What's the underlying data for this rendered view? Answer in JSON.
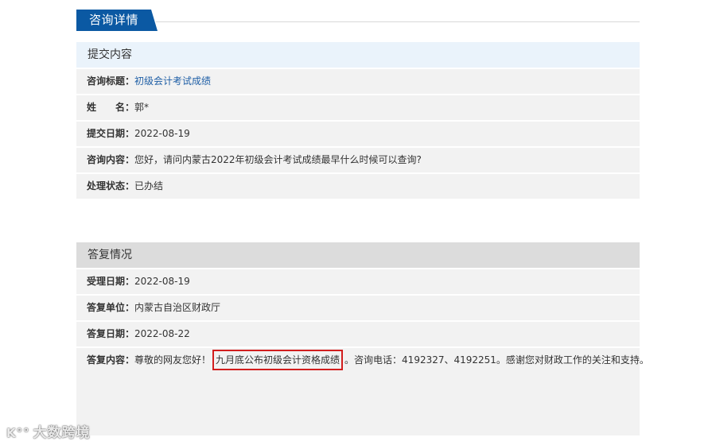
{
  "page_title": "咨询详情",
  "submit": {
    "header": "提交内容",
    "title_label": "咨询标题：",
    "title_value": "初级会计考试成绩",
    "name_label": "姓　　名：",
    "name_value": "郭*",
    "date_label": "提交日期：",
    "date_value": "2022-08-19",
    "content_label": "咨询内容：",
    "content_value": "您好，请问内蒙古2022年初级会计考试成绩最早什么时候可以查询?",
    "status_label": "处理状态：",
    "status_value": "已办结"
  },
  "reply": {
    "header": "答复情况",
    "accept_date_label": "受理日期：",
    "accept_date_value": "2022-08-19",
    "unit_label": "答复单位：",
    "unit_value": "内蒙古自治区财政厅",
    "reply_date_label": "答复日期：",
    "reply_date_value": "2022-08-22",
    "content_label": "答复内容：",
    "content_prefix": "尊敬的网友您好！",
    "content_highlight": "九月底公布初级会计资格成绩",
    "content_suffix": "。咨询电话：4192327、4192251。感谢您对财政工作的关注和支持。"
  },
  "watermark": {
    "logo": "K°°",
    "text": "大数跨境"
  },
  "colors": {
    "title_tab": "#0b59a3",
    "submit_header_bg": "#eaf3fb",
    "reply_header_bg": "#dcdcdc",
    "row_bg": "#f2f2f2",
    "link": "#1f5fa6",
    "highlight_border": "#d21e1e"
  }
}
